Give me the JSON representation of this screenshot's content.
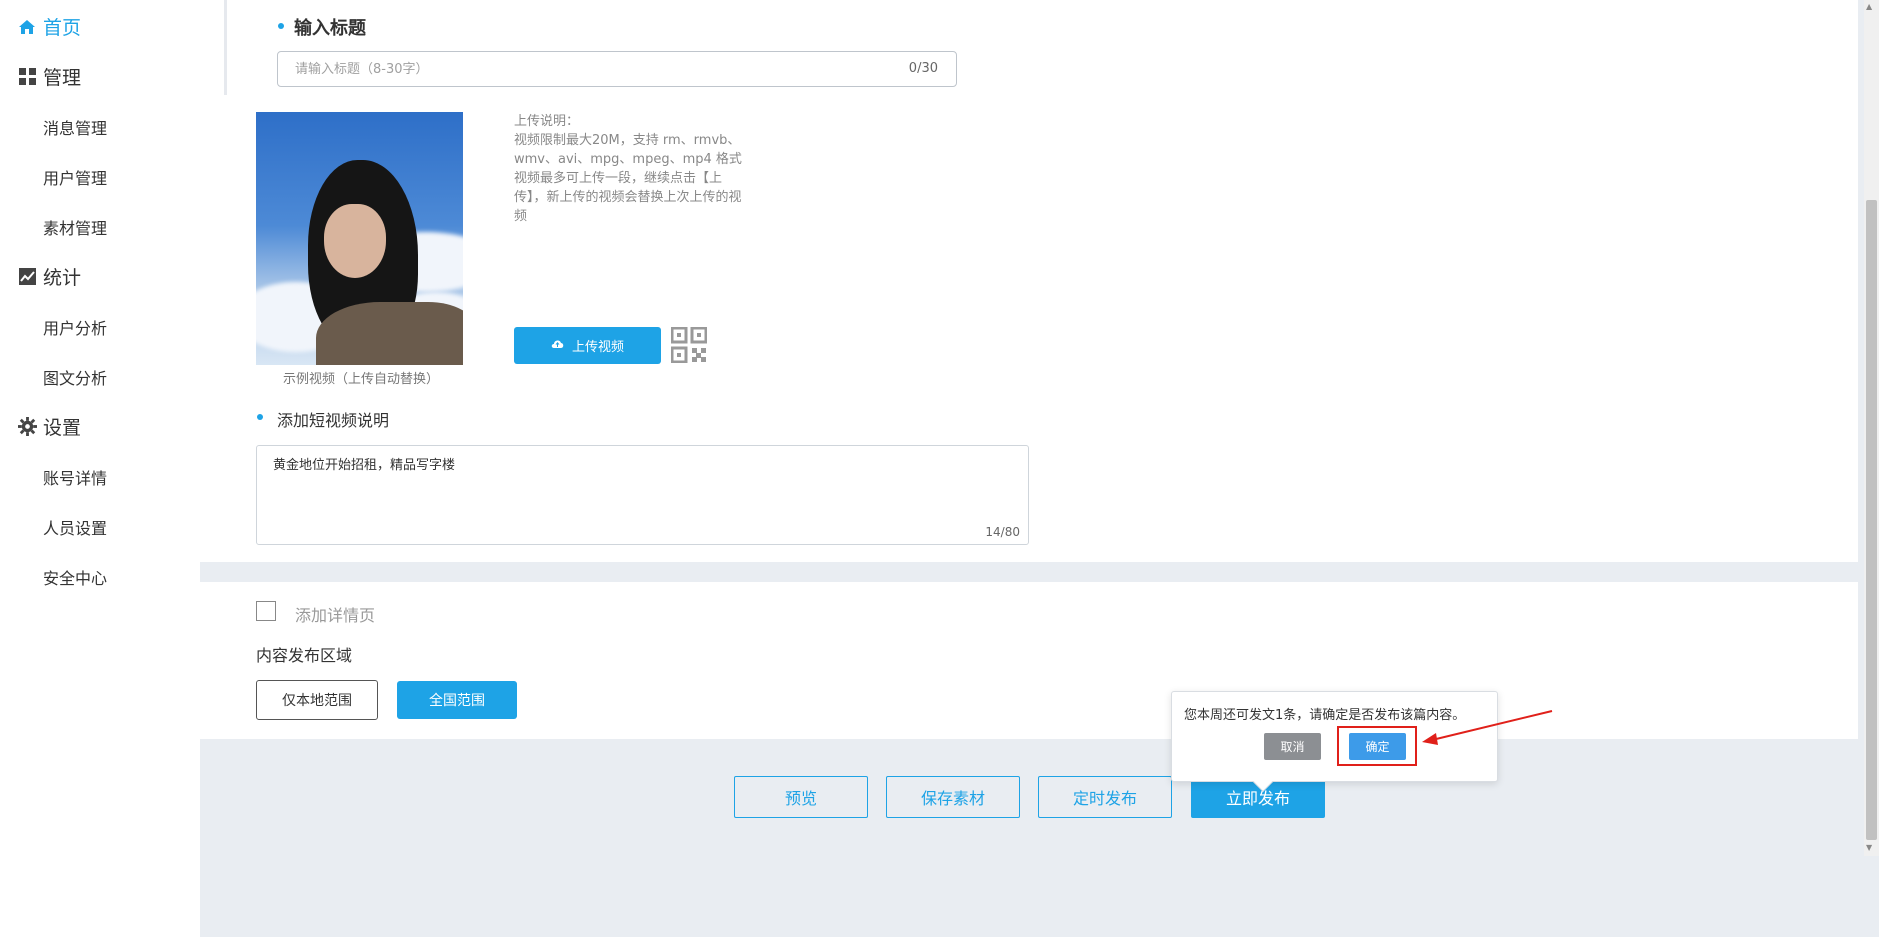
{
  "sidebar": {
    "home": "首页",
    "groups": [
      {
        "label": "管理",
        "icon": "grid-icon",
        "items": [
          "消息管理",
          "用户管理",
          "素材管理"
        ]
      },
      {
        "label": "统计",
        "icon": "chart-icon",
        "items": [
          "用户分析",
          "图文分析"
        ]
      },
      {
        "label": "设置",
        "icon": "gear-icon",
        "items": [
          "账号详情",
          "人员设置",
          "安全中心"
        ]
      }
    ]
  },
  "title_section": {
    "label": "输入标题",
    "placeholder": "请输入标题（8-30字）",
    "count": "0/30"
  },
  "video": {
    "caption": "示例视频（上传自动替换）",
    "note_lines": [
      "上传说明：",
      "视频限制最大20M，支持 rm、rmvb、",
      "wmv、avi、mpg、mpeg、mp4 格式",
      "视频最多可上传一段，继续点击【上",
      "传】，新上传的视频会替换上次上传的视",
      "频"
    ],
    "upload_label": "上传视频"
  },
  "description": {
    "label": "添加短视频说明",
    "text": "黄金地位开始招租，精品写字楼",
    "count": "14/80"
  },
  "detail": {
    "label": "添加详情页"
  },
  "region": {
    "label": "内容发布区域",
    "local": "仅本地范围",
    "national": "全国范围"
  },
  "actions": {
    "preview": "预览",
    "save": "保存素材",
    "schedule": "定时发布",
    "publish": "立即发布"
  },
  "popover": {
    "message": "您本周还可发文1条，请确定是否发布该篇内容。",
    "cancel": "取消",
    "confirm": "确定"
  },
  "colors": {
    "accent": "#1ea3e6",
    "annotation": "#e0201a"
  }
}
